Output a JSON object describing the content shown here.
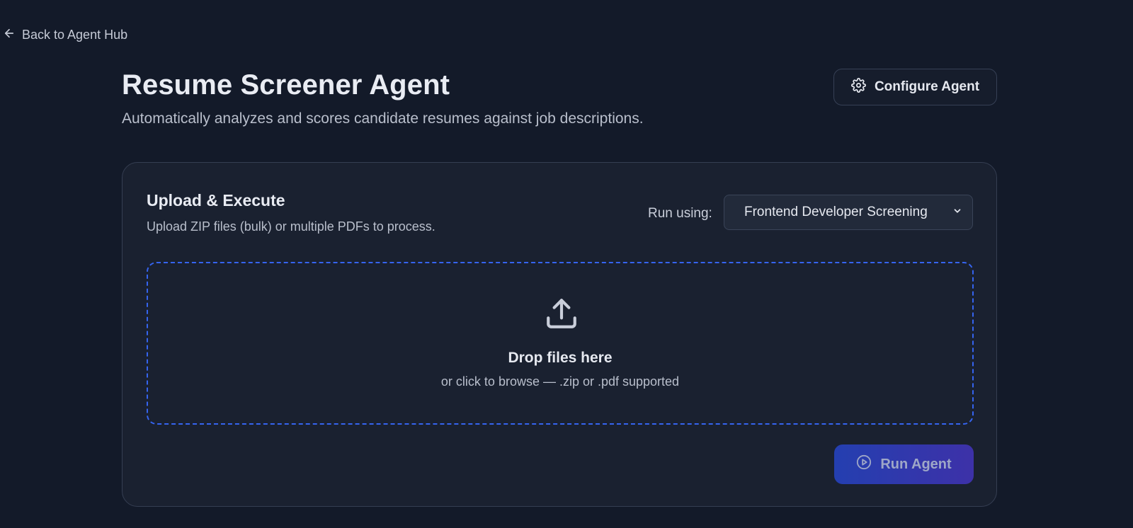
{
  "nav": {
    "back_label": "Back to Agent Hub",
    "back_icon": "arrow-left-icon"
  },
  "header": {
    "title": "Resume Screener Agent",
    "subtitle": "Automatically analyzes and scores candidate resumes against job descriptions.",
    "configure_label": "Configure Agent",
    "configure_icon": "gear-icon"
  },
  "upload_card": {
    "title": "Upload & Execute",
    "description": "Upload ZIP files (bulk) or multiple PDFs to process.",
    "run_using_label": "Run using:",
    "selected_profile": "Frontend Developer Screening",
    "dropzone": {
      "icon": "upload-icon",
      "title": "Drop files here",
      "hint": "or click to browse — .zip or .pdf supported"
    },
    "run_label": "Run Agent",
    "run_icon": "play-circle-icon"
  },
  "colors": {
    "background": "#131a29",
    "card": "#1a2130",
    "dropzone_border": "#3564f0",
    "run_gradient_start": "#243fb0",
    "run_gradient_end": "#3d31a8"
  }
}
